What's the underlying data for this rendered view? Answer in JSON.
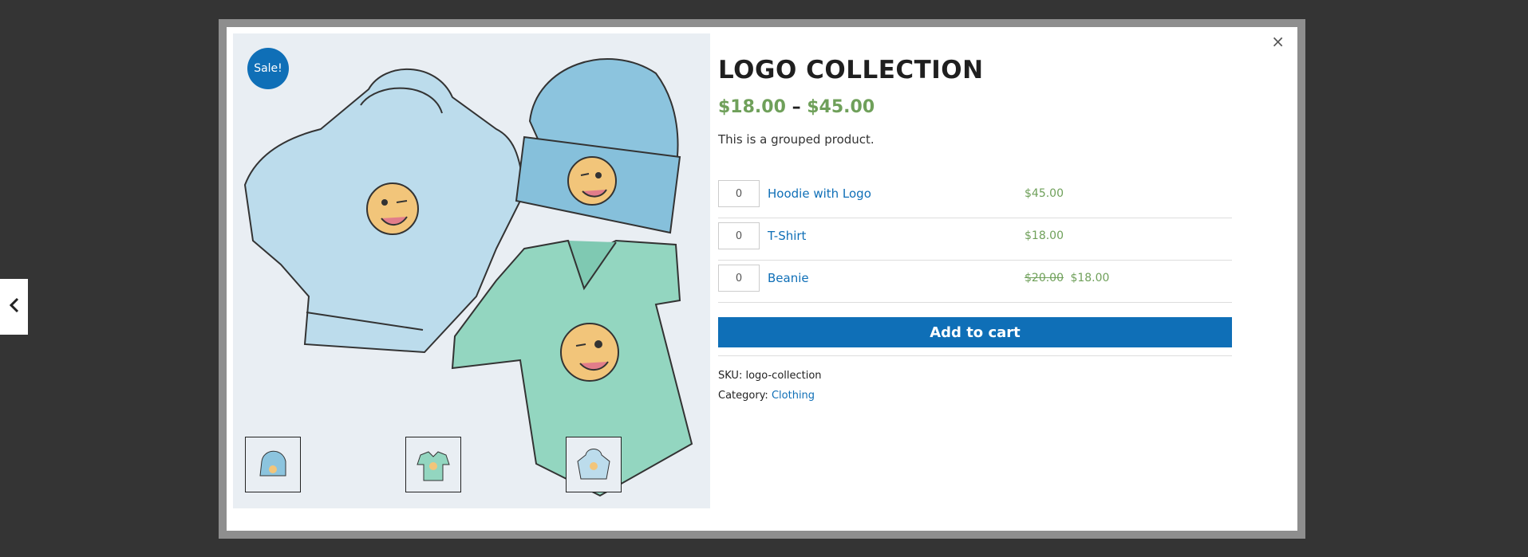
{
  "navigation": {
    "prev_icon": "chevron-left-icon"
  },
  "modal": {
    "close_label": "×",
    "gallery": {
      "sale_badge": "Sale!",
      "thumbnails": [
        {
          "name": "beanie-thumbnail"
        },
        {
          "name": "tshirt-thumbnail"
        },
        {
          "name": "hoodie-thumbnail"
        }
      ]
    },
    "product": {
      "title": "LOGO COLLECTION",
      "price_low": "$18.00",
      "price_sep": "–",
      "price_high": "$45.00",
      "description": "This is a grouped product.",
      "items": [
        {
          "qty": "0",
          "name": "Hoodie with Logo",
          "price_old": "",
          "price": "$45.00"
        },
        {
          "qty": "0",
          "name": "T-Shirt",
          "price_old": "",
          "price": "$18.00"
        },
        {
          "qty": "0",
          "name": "Beanie",
          "price_old": "$20.00",
          "price": "$18.00"
        }
      ],
      "add_to_cart": "Add to cart",
      "sku_label": "SKU:",
      "sku_value": "logo-collection",
      "category_label": "Category:",
      "category_value": "Clothing"
    }
  },
  "colors": {
    "accent": "#0f6fb7",
    "price": "#6fa05a",
    "overlay": "#343434"
  }
}
